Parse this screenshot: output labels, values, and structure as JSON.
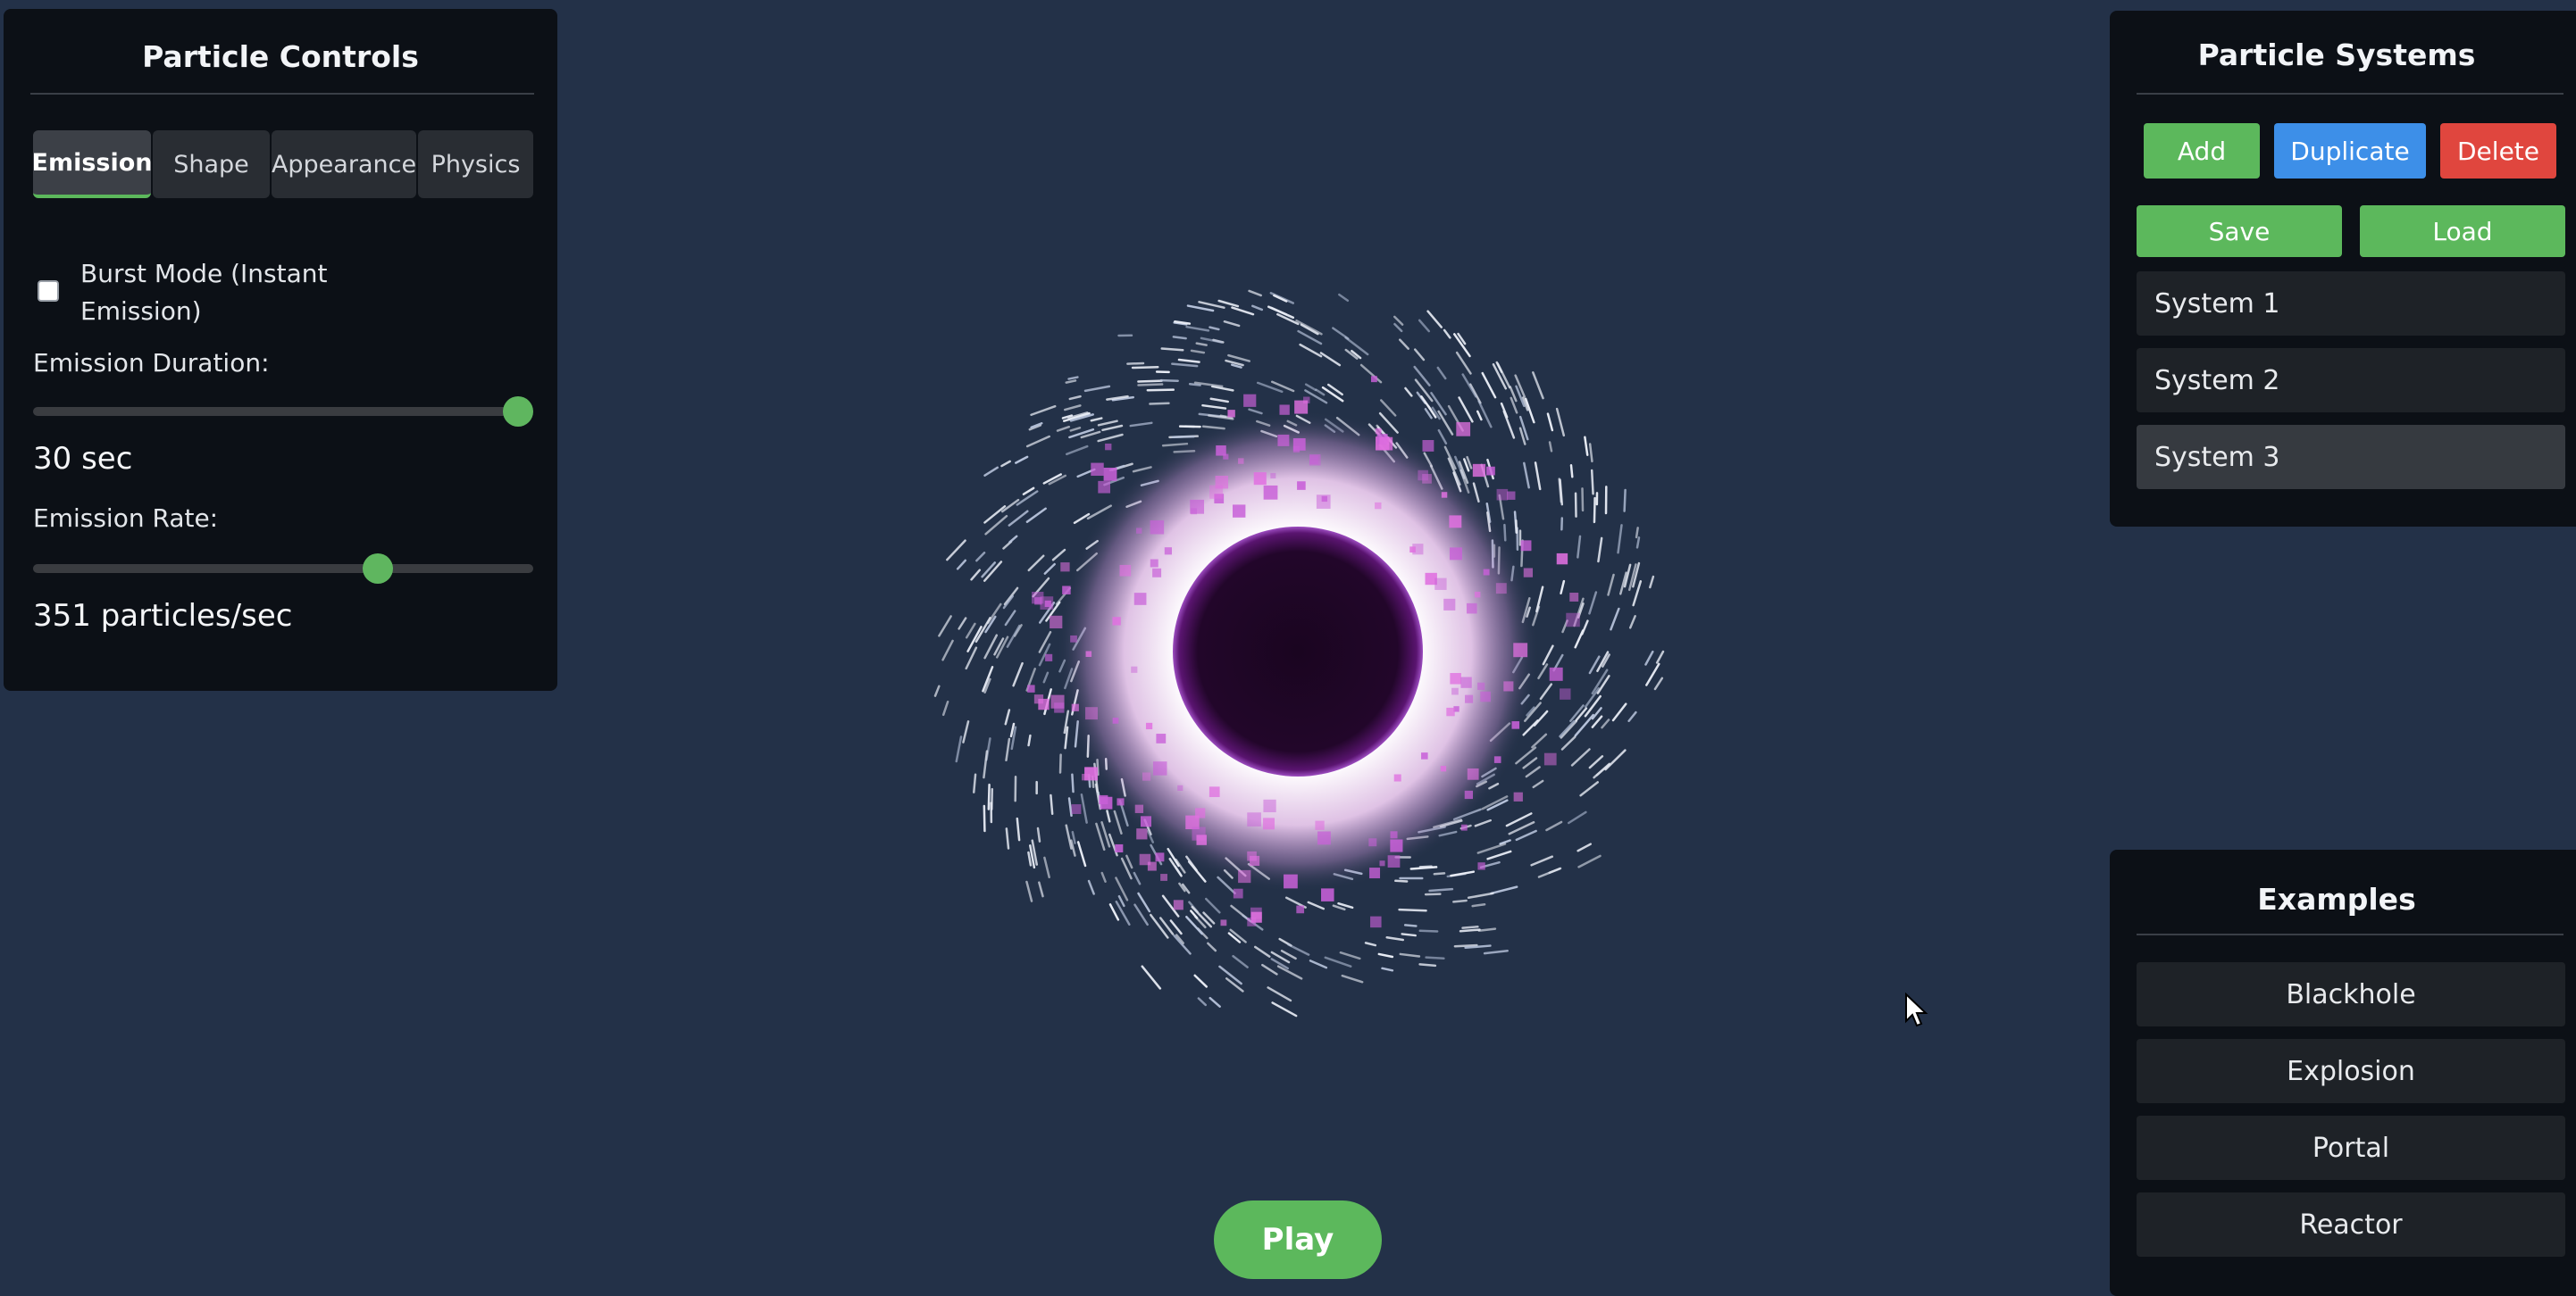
{
  "controls": {
    "title": "Particle Controls",
    "tabs": [
      "Emission",
      "Shape",
      "Appearance",
      "Physics"
    ],
    "active_tab": "Emission",
    "burst_mode_label": "Burst Mode (Instant Emission)",
    "burst_mode_checked": false,
    "emission_duration_label": "Emission Duration:",
    "emission_duration_value": "30 sec",
    "emission_duration_fraction": 0.97,
    "emission_rate_label": "Emission Rate:",
    "emission_rate_value": "351 particles/sec",
    "emission_rate_fraction": 0.69
  },
  "systems": {
    "title": "Particle Systems",
    "add_label": "Add",
    "duplicate_label": "Duplicate",
    "delete_label": "Delete",
    "save_label": "Save",
    "load_label": "Load",
    "items": [
      "System 1",
      "System 2",
      "System 3"
    ],
    "selected": "System 3"
  },
  "examples": {
    "title": "Examples",
    "items": [
      "Blackhole",
      "Explosion",
      "Portal",
      "Reactor"
    ]
  },
  "play_label": "Play",
  "colors": {
    "background": "#233148",
    "panel": "#0c1016",
    "accent_green": "#5cb85c",
    "accent_blue": "#3d8fe8",
    "accent_red": "#e0463e",
    "particle_pink": "#e070e0",
    "core_dark": "#1a0520"
  }
}
